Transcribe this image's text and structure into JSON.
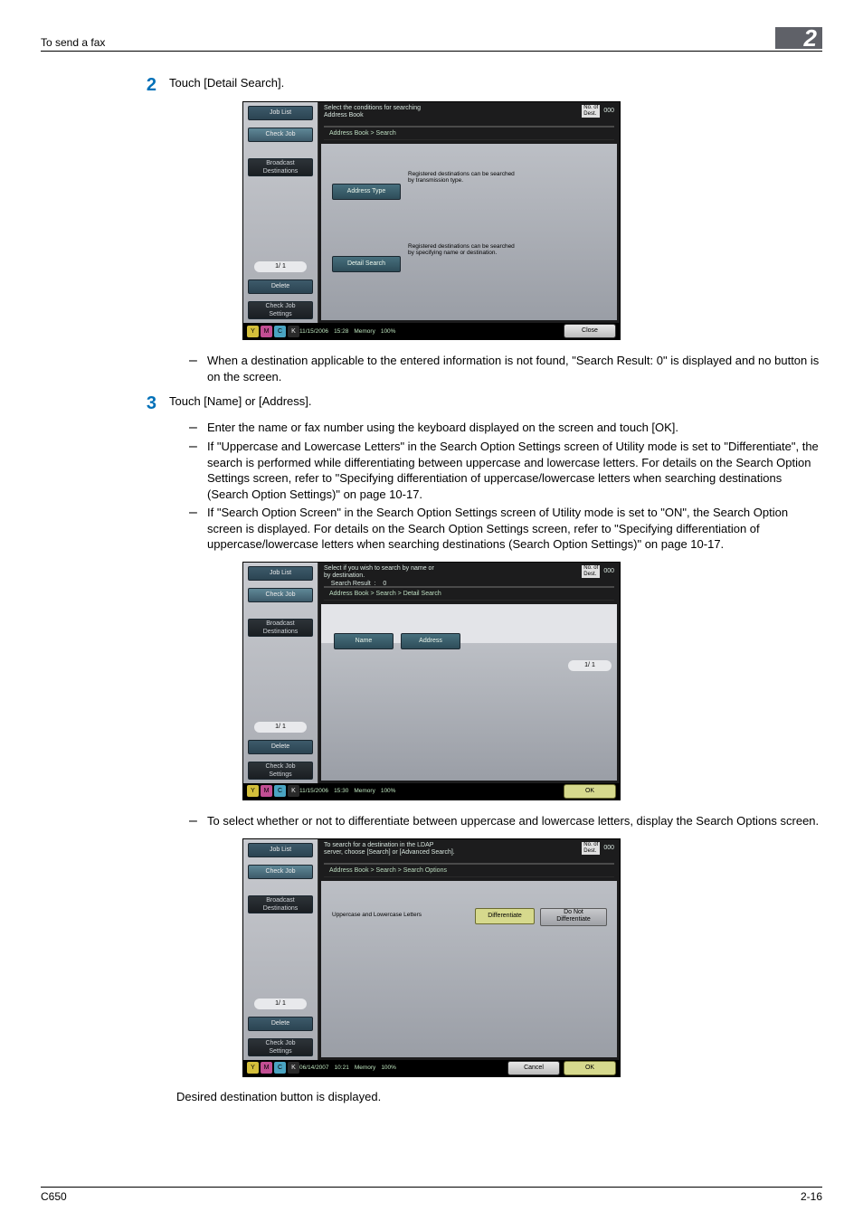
{
  "header": {
    "left": "To send a fax",
    "chapter": "2"
  },
  "footer": {
    "left": "C650",
    "right": "2-16"
  },
  "steps": {
    "s2": {
      "num": "2",
      "text": "Touch [Detail Search].",
      "bullets": [
        "When a destination applicable to the entered information is not found, \"Search Result: 0\" is displayed and no button is on the screen."
      ]
    },
    "s3": {
      "num": "3",
      "text": "Touch [Name] or [Address].",
      "bullets": [
        "Enter the name or fax number using the keyboard displayed on the screen and touch [OK].",
        "If \"Uppercase and Lowercase Letters\" in the Search Option Settings screen of Utility mode is set to \"Differentiate\", the search is performed while differentiating between uppercase and lowercase letters. For details on the Search Option Settings screen, refer to \"Specifying differentiation of uppercase/lowercase letters when searching destinations (Search Option Settings)\" on page 10-17.",
        "If \"Search Option Screen\" in the Search Option Settings screen of Utility mode is set to \"ON\", the Search Option screen is displayed. For details on the Search Option Settings screen, refer to \"Specifying differentiation of uppercase/lowercase letters when searching destinations (Search Option Settings)\" on page 10-17."
      ],
      "bullets2": [
        "To select whether or not to differentiate between uppercase and lowercase letters, display the Search Options screen."
      ]
    }
  },
  "final": "Desired destination button is displayed.",
  "common": {
    "sidebar": {
      "joblist": "Job List",
      "checkjob": "Check Job",
      "broadcast": "Broadcast\nDestinations",
      "page": "1/  1",
      "delete": "Delete",
      "checkjobsettings": "Check Job\nSettings"
    },
    "chips": [
      "Y",
      "M",
      "C",
      "K"
    ],
    "counter_label": "No. of\nDest.",
    "counter_value": "000"
  },
  "screen1": {
    "title": "Select the conditions for searching\nAddress Book",
    "crumb": "Address Book > Search",
    "cap1": "Registered destinations can be searched\nby transmission type.",
    "btn1": "Address Type",
    "cap2": "Registered destinations can be searched\nby specifying name or destination.",
    "btn2": "Detail Search",
    "date": "11/15/2006",
    "time": "15:28",
    "mem": "Memory",
    "mempct": "100%",
    "close": "Close"
  },
  "screen2": {
    "title": "Select if you wish to search by name or\nby destination.\n    Search Result  :    0",
    "crumb": "Address Book > Search > Detail Search",
    "btn1": "Name",
    "btn2": "Address",
    "page": "1/  1",
    "date": "11/15/2006",
    "time": "15:30",
    "mem": "Memory",
    "mempct": "100%",
    "ok": "OK"
  },
  "screen3": {
    "title": "To search for a destination in the LDAP\nserver, choose [Search] or [Advanced Search].",
    "crumb": "Address Book > Search > Search Options",
    "label": "Uppercase and Lowercase Letters",
    "opt1": "Differentiate",
    "opt2": "Do Not\nDifferentiate",
    "date": "06/14/2007",
    "time": "10:21",
    "mem": "Memory",
    "mempct": "100%",
    "cancel": "Cancel",
    "ok": "OK"
  }
}
